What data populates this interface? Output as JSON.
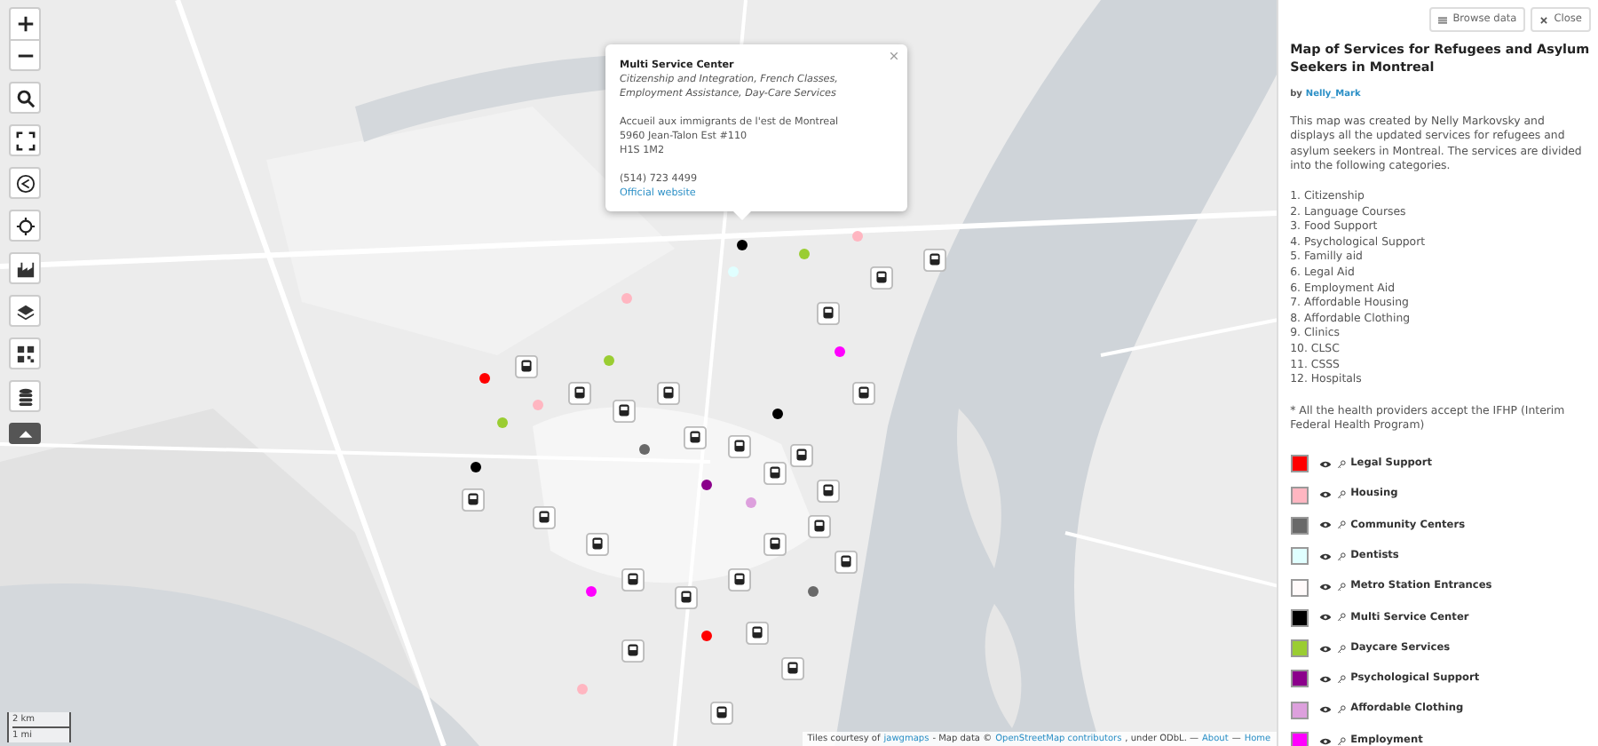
{
  "map": {
    "popup": {
      "title": "Multi Service Center",
      "services": "Citizenship and Integration, French Classes, Employment Assistance, Day-Care Services",
      "address": [
        "Accueil aux immigrants de l'est de Montreal",
        "5960 Jean-Talon Est #110",
        "H1S 1M2"
      ],
      "phone": "(514) 723 4499",
      "link": "Official website"
    },
    "scale": [
      "2 km",
      "1 mi"
    ],
    "attribution": [
      {
        "kind": "text",
        "text": "Tiles courtesy of"
      },
      {
        "kind": "link",
        "text": "jawgmaps"
      },
      {
        "kind": "text",
        "text": "- Map data ©"
      },
      {
        "kind": "link",
        "text": "OpenStreetMap contributors"
      },
      {
        "kind": "text",
        "text": ", under ODbL. —"
      },
      {
        "kind": "link",
        "text": "About"
      },
      {
        "kind": "text",
        "text": "—"
      },
      {
        "kind": "link",
        "text": "Home"
      }
    ]
  },
  "panel": {
    "buttons": [
      {
        "kind": "browse",
        "label": "Browse data"
      },
      {
        "kind": "close",
        "label": "Close"
      }
    ],
    "title": "Map of Services for Refugees and Asylum Seekers in Montreal",
    "byline": {
      "prefix": "by",
      "author": "Nelly_Mark"
    },
    "description": "This map was created by Nelly Markovsky and displays all the updated services for refugees and asylum seekers in Montreal. The services are divided into the following categories.",
    "categories": [
      "1. Citizenship",
      "2. Language Courses",
      "3. Food Support",
      "4. Psychological Support",
      "5. Familly aid",
      "6. Legal Aid",
      "6. Employment Aid",
      "7. Affordable Housing",
      "8. Affordable Clothing",
      "9. Clinics",
      "10. CLSC",
      "11. CSSS",
      "12. Hospitals"
    ],
    "note": "* All the health providers accept the IFHP (Interim Federal Health Program)",
    "legend": [
      {
        "label": "Legal Support",
        "color": "#ff0000"
      },
      {
        "label": "Housing",
        "color": "#ffb6c1"
      },
      {
        "label": "Community Centers",
        "color": "#696969"
      },
      {
        "label": "Dentists",
        "color": "#e0ffff"
      },
      {
        "label": "Metro Station Entrances",
        "color": "#fffafa"
      },
      {
        "label": "Multi Service Center",
        "color": "#000000"
      },
      {
        "label": "Daycare Services",
        "color": "#9acd32"
      },
      {
        "label": "Psychological Support",
        "color": "#8b008b"
      },
      {
        "label": "Affordable Clothing",
        "color": "#dda0dd"
      },
      {
        "label": "Employment",
        "color": "#ff00ff"
      }
    ]
  }
}
